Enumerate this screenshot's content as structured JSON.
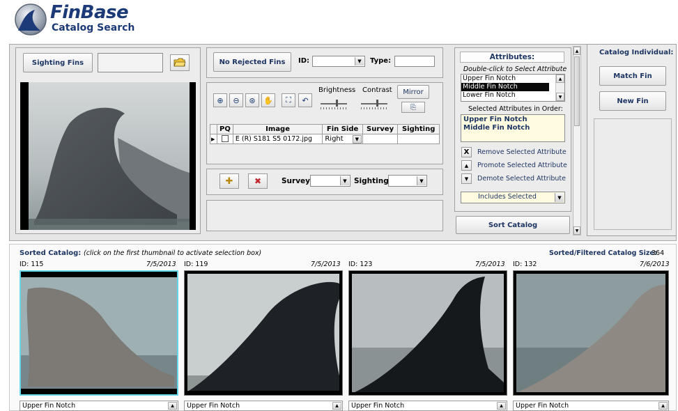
{
  "app": {
    "title": "FinBase",
    "subtitle": "Catalog Search"
  },
  "sighting": {
    "sighting_fins_label": "Sighting Fins",
    "no_rejected_label": "No Rejected Fins",
    "id_label": "ID:",
    "type_label": "Type:",
    "brightness_label": "Brightness",
    "contrast_label": "Contrast",
    "mirror_label": "Mirror",
    "table": {
      "headers": [
        "PQ",
        "Image",
        "Fin Side",
        "Survey",
        "Sighting"
      ],
      "rows": [
        {
          "image": "E (R) S181 S5 0172.jpg",
          "fin_side": "Right",
          "survey": "",
          "sighting": ""
        }
      ]
    },
    "survey_label": "Survey:",
    "sighting_label": "Sighting:"
  },
  "attributes": {
    "title": "Attributes:",
    "hint": "Double-click to Select Attribute",
    "list": [
      "Upper Fin Notch",
      "Middle Fin Notch",
      "Lower Fin Notch"
    ],
    "selected_index": 1,
    "selected_order_label": "Selected Attributes in Order:",
    "selected": [
      "Upper Fin Notch",
      "Middle Fin Notch"
    ],
    "remove_label": "Remove Selected Attribute",
    "promote_label": "Promote Selected Attribute",
    "demote_label": "Demote Selected Attribute",
    "filter_value": "Includes Selected",
    "sort_label": "Sort Catalog"
  },
  "catalog_individual": {
    "title": "Catalog Individual:",
    "match_label": "Match Fin",
    "new_label": "New Fin"
  },
  "sorted": {
    "label": "Sorted Catalog:",
    "hint": "(click on the first thumbnail to activate selection box)",
    "size_label": "Sorted/Filtered Catalog Size:",
    "size_value": "364",
    "thumbs": [
      {
        "id": "ID: 115",
        "date": "7/5/2013",
        "caption": "Upper Fin Notch"
      },
      {
        "id": "ID: 119",
        "date": "7/5/2013",
        "caption": "Upper Fin Notch"
      },
      {
        "id": "ID: 123",
        "date": "7/5/2013",
        "caption": "Upper Fin Notch"
      },
      {
        "id": "ID: 132",
        "date": "7/6/2013",
        "caption": "Upper Fin Notch"
      }
    ]
  },
  "colors": {
    "title_blue": "#1c3a78",
    "list_selection": "#0a0a0a",
    "selected_box_bg": "#fffbe0",
    "thumb_highlight": "#66d6e8"
  },
  "icons": {
    "folder": "folder-open-icon",
    "zoom_in": "zoom-in-icon",
    "zoom_out": "zoom-out-icon",
    "zoom_fit": "zoom-fit-icon",
    "pan": "hand-icon",
    "fullscreen": "fullscreen-icon",
    "undo": "undo-icon",
    "copy": "copy-icon",
    "add": "add-icon",
    "delete": "delete-icon"
  }
}
